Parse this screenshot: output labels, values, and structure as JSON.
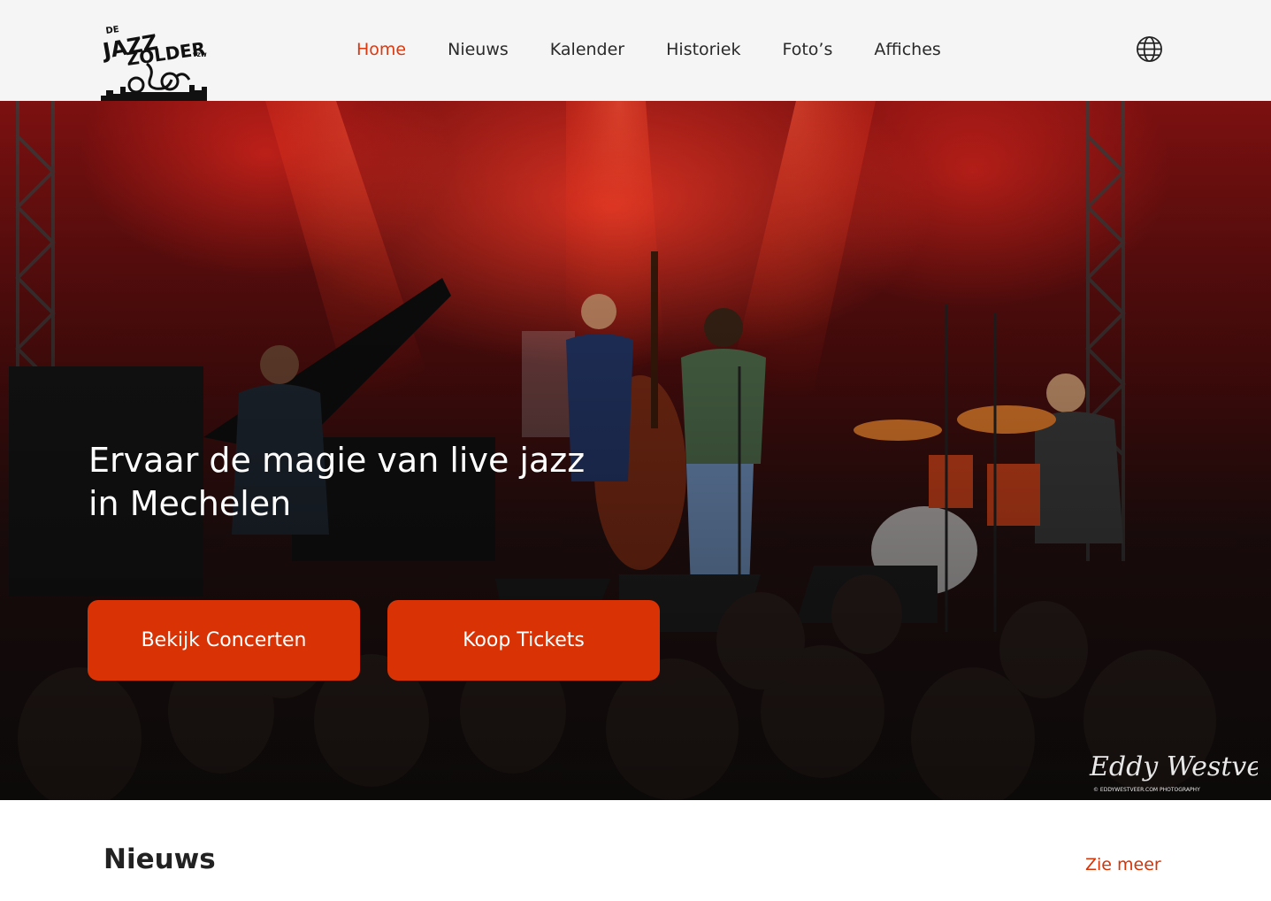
{
  "header": {
    "logo": {
      "alt": "De Jazz Zolder vzw",
      "line1": "DE",
      "line2": "JAZZ",
      "line3": "ZOLDER",
      "suffix": "VZW"
    },
    "nav": [
      {
        "label": "Home",
        "active": true
      },
      {
        "label": "Nieuws",
        "active": false
      },
      {
        "label": "Kalender",
        "active": false
      },
      {
        "label": "Historiek",
        "active": false
      },
      {
        "label": "Foto’s",
        "active": false
      },
      {
        "label": "Affiches",
        "active": false
      }
    ],
    "language_icon": "globe-icon"
  },
  "hero": {
    "title_line1": "Ervaar de magie van live jazz",
    "title_line2": "in Mechelen",
    "primary_button": "Bekijk Concerten",
    "secondary_button": "Koop Tickets",
    "watermark_signature": "Eddy Westveer",
    "watermark_credit": "© EDDYWESTVEER.COM PHOTOGRAPHY"
  },
  "news": {
    "title": "Nieuws",
    "see_more": "Zie meer"
  },
  "colors": {
    "accent": "#d93205",
    "nav_active": "#d93a12",
    "header_bg": "#f5f5f5"
  }
}
